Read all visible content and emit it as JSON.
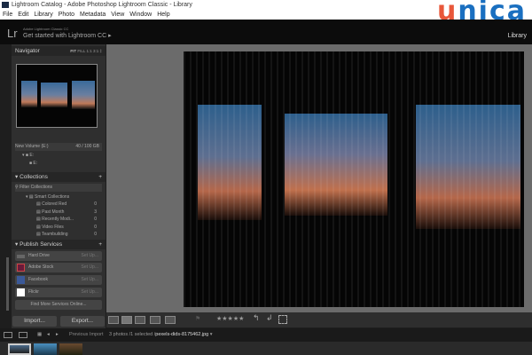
{
  "window": {
    "title": "Lightroom Catalog - Adobe Photoshop Lightroom Classic - Library"
  },
  "menu": [
    "File",
    "Edit",
    "Library",
    "Photo",
    "Metadata",
    "View",
    "Window",
    "Help"
  ],
  "watermark": "unica",
  "identity": {
    "logo": "Lr",
    "product": "Adobe Lightroom Classic CC",
    "promo": "Get started with Lightroom CC ▸",
    "module": "Library"
  },
  "navigator": {
    "title": "Navigator",
    "zoom": [
      "FIT",
      "FILL",
      "1:1",
      "3:1 ‡"
    ]
  },
  "folders": {
    "volume": "New Volume (E:)",
    "size": "40 / 100 GB",
    "items": [
      "E:",
      "E:"
    ]
  },
  "collections": {
    "title": "Collections",
    "filter": "Filter Collections",
    "group": "Smart Collections",
    "items": [
      {
        "name": "Colored Red",
        "count": "0"
      },
      {
        "name": "Past Month",
        "count": "3"
      },
      {
        "name": "Recently Modi...",
        "count": "0"
      },
      {
        "name": "Video Files",
        "count": "0"
      },
      {
        "name": "Teambuilding",
        "count": "0"
      }
    ]
  },
  "publish": {
    "title": "Publish Services",
    "services": [
      {
        "name": "Hard Drive",
        "action": "Set Up..."
      },
      {
        "name": "Adobe Stock",
        "action": "Set Up..."
      },
      {
        "name": "Facebook",
        "action": "Set Up..."
      },
      {
        "name": "Flickr",
        "action": "Set Up..."
      }
    ],
    "more": "Find More Services Online..."
  },
  "buttons": {
    "import": "Import...",
    "export": "Export..."
  },
  "toolbar": {
    "stars": "★★★★★"
  },
  "filmstrip": {
    "source": "Previous Import",
    "status": "3 photos /1 selected /",
    "file": "pexels-dids-8175462.jpg",
    "caret": "▾"
  }
}
